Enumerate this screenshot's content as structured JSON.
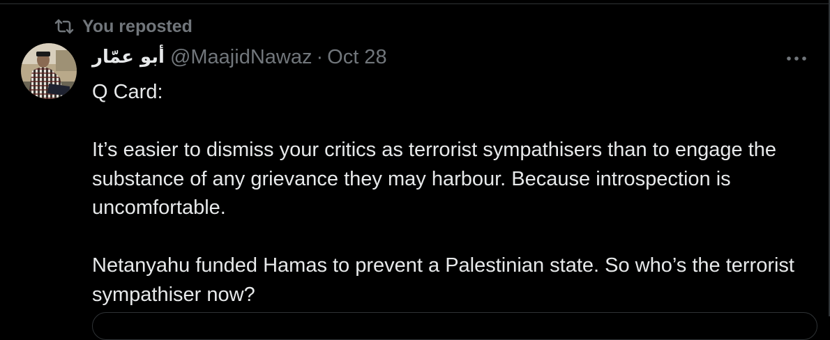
{
  "repost": {
    "label": "You reposted",
    "icon": "repost-icon"
  },
  "tweet": {
    "display_name": "أبو عمّار",
    "handle": "@MaajidNawaz",
    "separator": "·",
    "time": "Oct 28",
    "paragraphs": [
      "Q Card:",
      "It’s easier to dismiss your critics as terrorist sympathisers than to engage the substance of any grievance they may harbour. Because introspection is uncomfortable.",
      "Netanyahu funded Hamas to prevent a Palestinian state. So who’s the terrorist sympathiser now?"
    ]
  },
  "colors": {
    "background": "#000000",
    "primary_text": "#e7e9ea",
    "secondary_text": "#71767b",
    "border": "#2f3336"
  }
}
